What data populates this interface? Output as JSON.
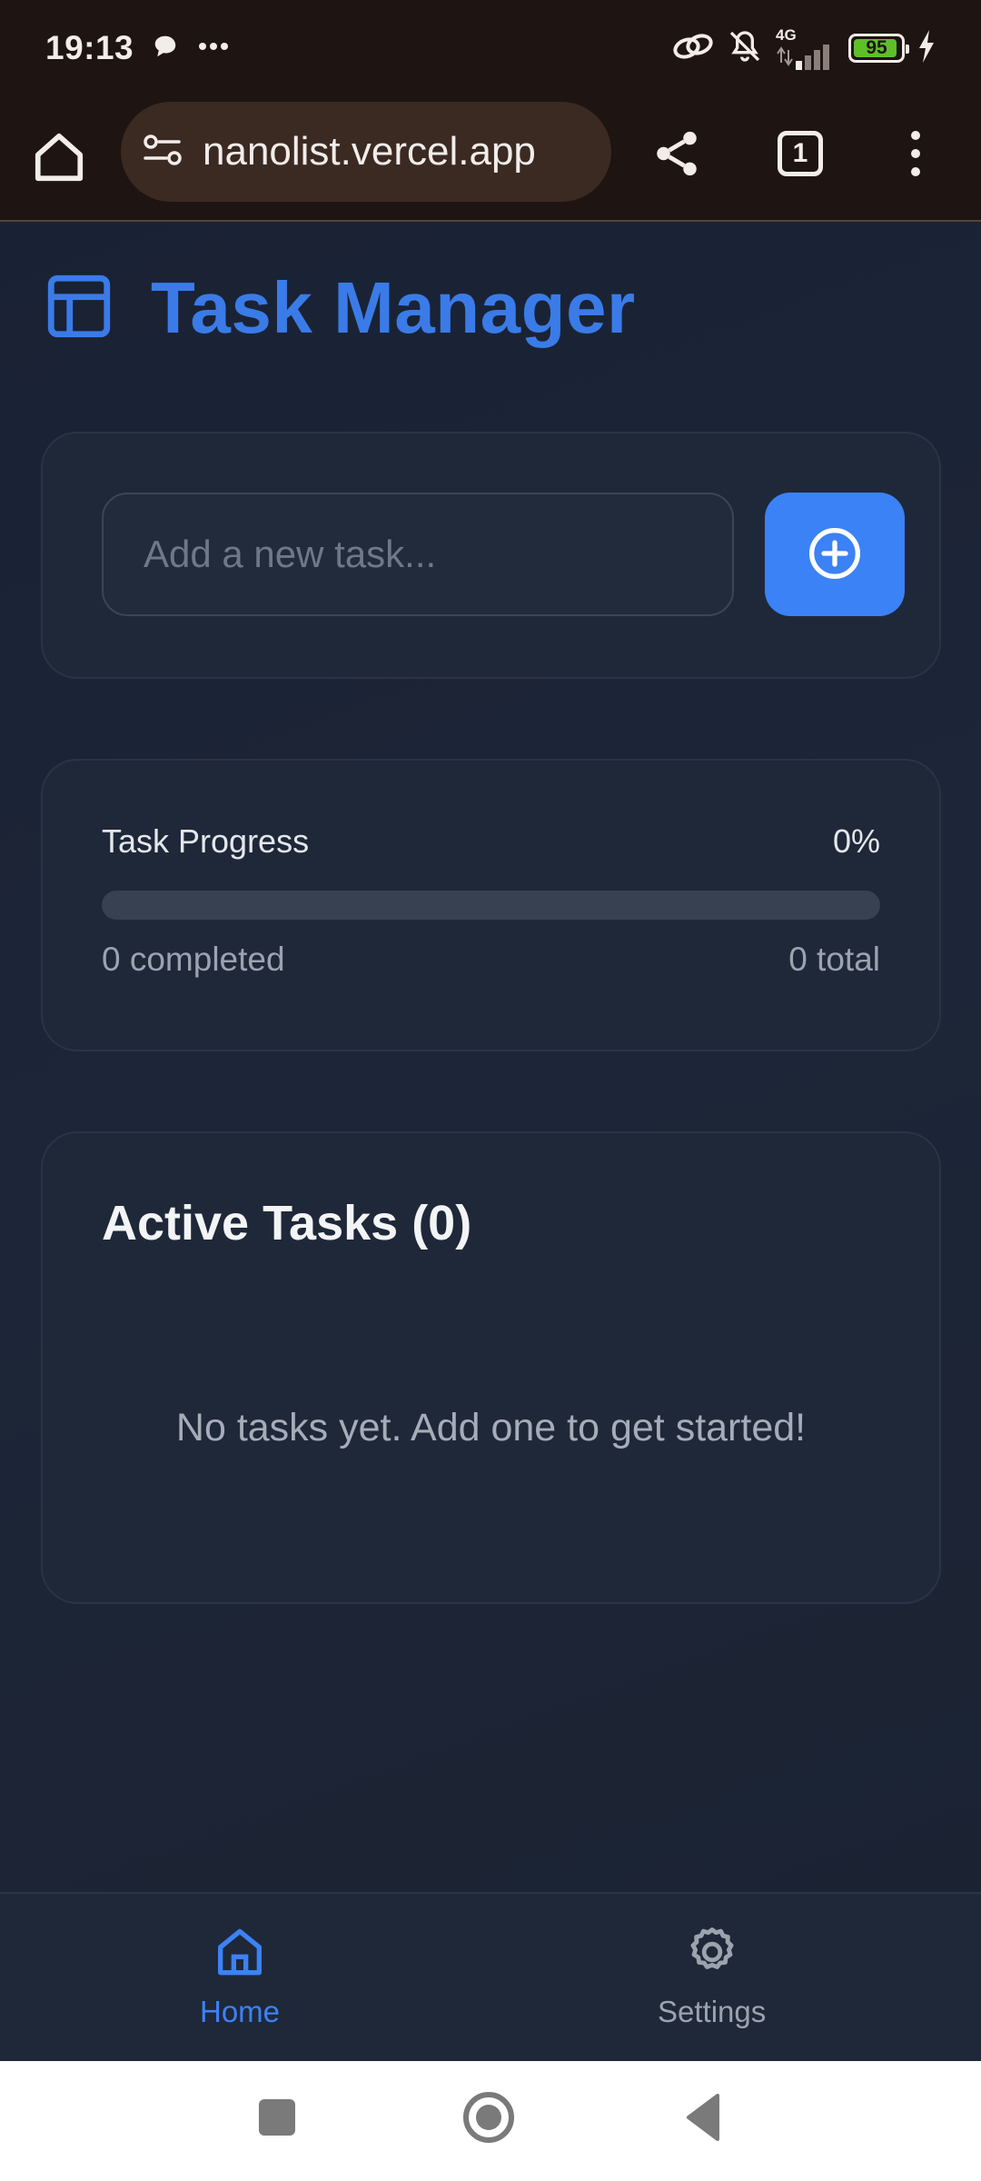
{
  "status_bar": {
    "time": "19:13",
    "network": "4G",
    "battery": "95",
    "battery_percent": 95,
    "icons": [
      "chat-bubble-icon",
      "more-dots-icon",
      "link-icon",
      "bell-off-icon",
      "signal-icon",
      "battery-icon",
      "charging-icon"
    ]
  },
  "browser": {
    "url": "nanolist.vercel.app",
    "tab_count": "1",
    "icons": [
      "home-icon",
      "site-settings-icon",
      "share-icon",
      "tabs-icon",
      "menu-icon"
    ]
  },
  "app": {
    "title": "Task Manager",
    "icon": "layout-icon",
    "accent_color": "#3b82f6"
  },
  "add_task": {
    "placeholder": "Add a new task...",
    "value": "",
    "button_icon": "plus-circle-icon"
  },
  "progress": {
    "label": "Task Progress",
    "percent_text": "0%",
    "percent": 0,
    "completed_text": "0 completed",
    "total_text": "0 total"
  },
  "tasks": {
    "title": "Active Tasks (0)",
    "empty_message": "No tasks yet. Add one to get started!"
  },
  "bottom_nav": {
    "items": [
      {
        "label": "Home",
        "icon": "home-icon",
        "active": true
      },
      {
        "label": "Settings",
        "icon": "gear-icon",
        "active": false
      }
    ]
  },
  "system_nav": {
    "icons": [
      "recents-icon",
      "home-circle-icon",
      "back-icon"
    ]
  }
}
